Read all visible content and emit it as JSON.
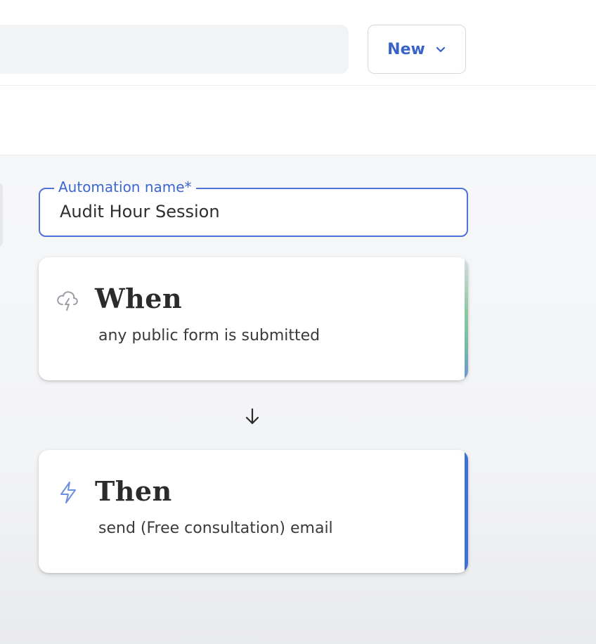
{
  "header": {
    "new_button_label": "New"
  },
  "automation": {
    "name_label": "Automation name*",
    "name_value": "Audit Hour Session"
  },
  "steps": [
    {
      "icon": "cloud-lightning-icon",
      "title": "When",
      "description": "any public form is submitted"
    },
    {
      "icon": "lightning-bolt-icon",
      "title": "Then",
      "description": "send (Free consultation) email"
    }
  ],
  "connector_icon": "arrow-down-icon",
  "colors": {
    "accent_blue": "#3f6fd8",
    "field_border": "#4f72d6",
    "label_blue": "#3d66cf"
  }
}
